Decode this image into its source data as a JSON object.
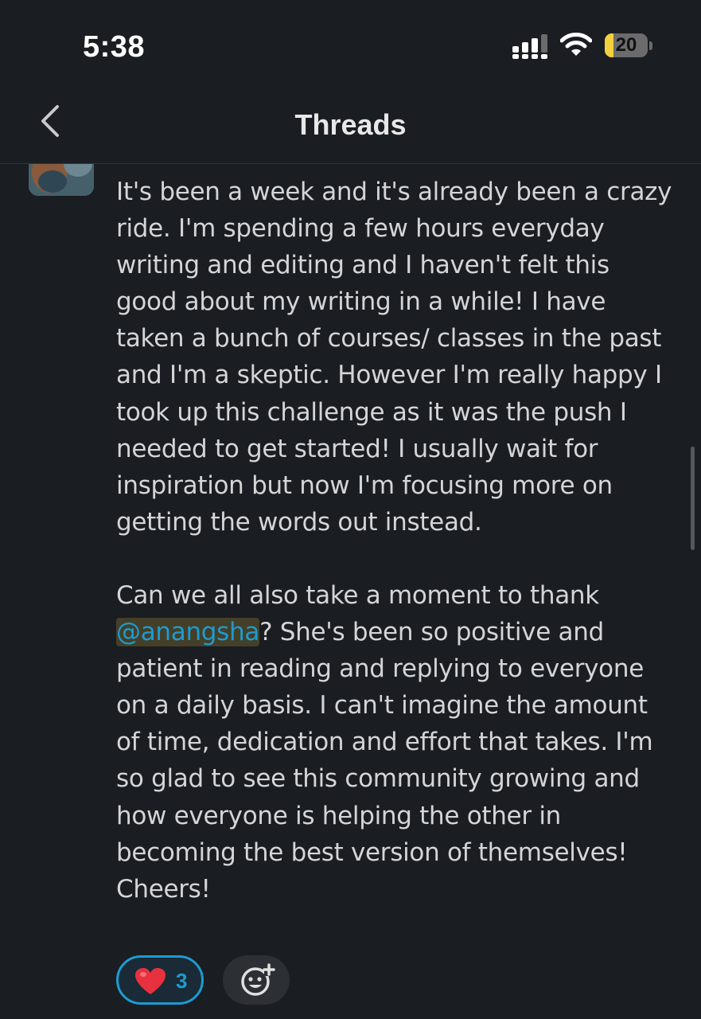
{
  "status_bar": {
    "time": "5:38",
    "battery_level": "20",
    "battery_fraction": 0.2
  },
  "nav": {
    "title": "Threads"
  },
  "message": {
    "paragraphs": [
      "It's been a week and it's already been a crazy ride. I'm spending a few hours everyday writing and editing and I haven't felt this good about my writing in a while! I have taken a bunch of courses/ classes in the past and I'm a skeptic. However I'm really happy I took up this challenge as it was the push I needed to get started! I usually wait for inspiration but now I'm focusing more on getting the words out instead."
    ],
    "mention_before": "Can we all also take a moment to thank",
    "mention": "@anangsha",
    "mention_after": "? She's been so positive and patient in reading and replying to everyone on a daily basis. I can't imagine the amount of time, dedication and effort that takes. I'm so glad to see this community growing and how everyone is helping the other in becoming the best version of themselves! Cheers!"
  },
  "reactions": {
    "heart_count": "3"
  },
  "icons": {
    "back": "chevron-left-icon",
    "signal": "signal-icon",
    "wifi": "wifi-icon",
    "heart": "heart-icon",
    "add_reaction": "add-reaction-icon"
  },
  "colors": {
    "background": "#1a1d21",
    "mention": "#1d9bd1",
    "reaction_border": "#1d9bd1",
    "battery": "#f4d03f"
  }
}
